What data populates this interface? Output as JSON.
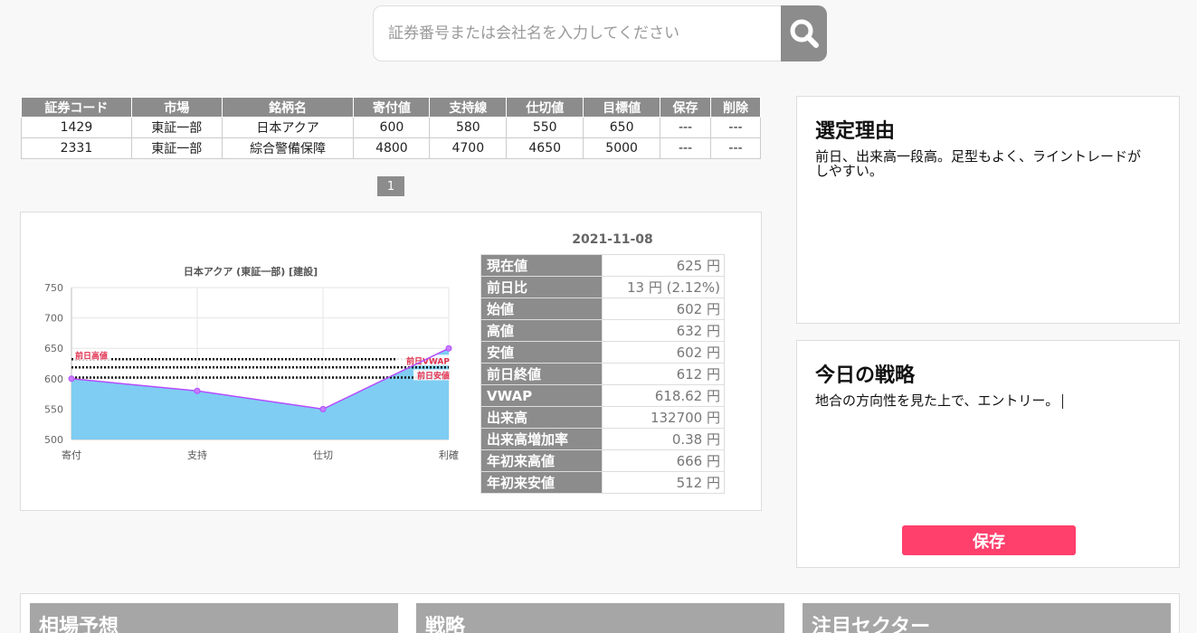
{
  "search": {
    "placeholder": "証券番号または会社名を入力してください"
  },
  "stock_table": {
    "headers": [
      "証券コード",
      "市場",
      "銘柄名",
      "寄付値",
      "支持線",
      "仕切値",
      "目標値",
      "保存",
      "削除"
    ],
    "rows": [
      [
        "1429",
        "東証一部",
        "日本アクア",
        "600",
        "580",
        "550",
        "650",
        "---",
        "---"
      ],
      [
        "2331",
        "東証一部",
        "綜合警備保障",
        "4800",
        "4700",
        "4650",
        "5000",
        "---",
        "---"
      ]
    ]
  },
  "pagination": {
    "current": "1"
  },
  "quote": {
    "date": "2021-11-08",
    "rows": [
      {
        "label": "現在値",
        "value": "625 円"
      },
      {
        "label": "前日比",
        "value": "13 円 (2.12%)"
      },
      {
        "label": "始値",
        "value": "602 円"
      },
      {
        "label": "高値",
        "value": "632 円"
      },
      {
        "label": "安値",
        "value": "602 円"
      },
      {
        "label": "前日終値",
        "value": "612 円"
      },
      {
        "label": "VWAP",
        "value": "618.62 円"
      },
      {
        "label": "出来高",
        "value": "132700 円"
      },
      {
        "label": "出来高増加率",
        "value": "0.38 円"
      },
      {
        "label": "年初来高値",
        "value": "666 円"
      },
      {
        "label": "年初来安値",
        "value": "512 円"
      }
    ]
  },
  "chart_data": {
    "type": "area",
    "title": "日本アクア (東証一部) [建設]",
    "categories": [
      "寄付",
      "支持",
      "仕切",
      "利確"
    ],
    "values": [
      600,
      580,
      550,
      650
    ],
    "ylim": [
      500,
      750
    ],
    "yticks": [
      500,
      550,
      600,
      650,
      700,
      750
    ],
    "grid": true,
    "reference_lines": [
      {
        "label": "前日高値",
        "value": 632
      },
      {
        "label": "前日VWAP",
        "value": 618.62
      },
      {
        "label": "前日安値",
        "value": 602
      }
    ],
    "colors": {
      "line": "#b44cff",
      "fill": "#7fcdf3",
      "label": "#e0304e"
    }
  },
  "reason": {
    "title": "選定理由",
    "text": "前日、出来高一段高。足型もよく、ライントレードがしやすい。"
  },
  "strategy": {
    "title": "今日の戦略",
    "text": "地合の方向性を見た上で、エントリー。",
    "save_label": "保存"
  },
  "bottom_sections": [
    "相場予想",
    "戦略",
    "注目セクター"
  ],
  "colors": {
    "header_gray": "#8c8c8c",
    "save_pink": "#ff3f6c"
  }
}
